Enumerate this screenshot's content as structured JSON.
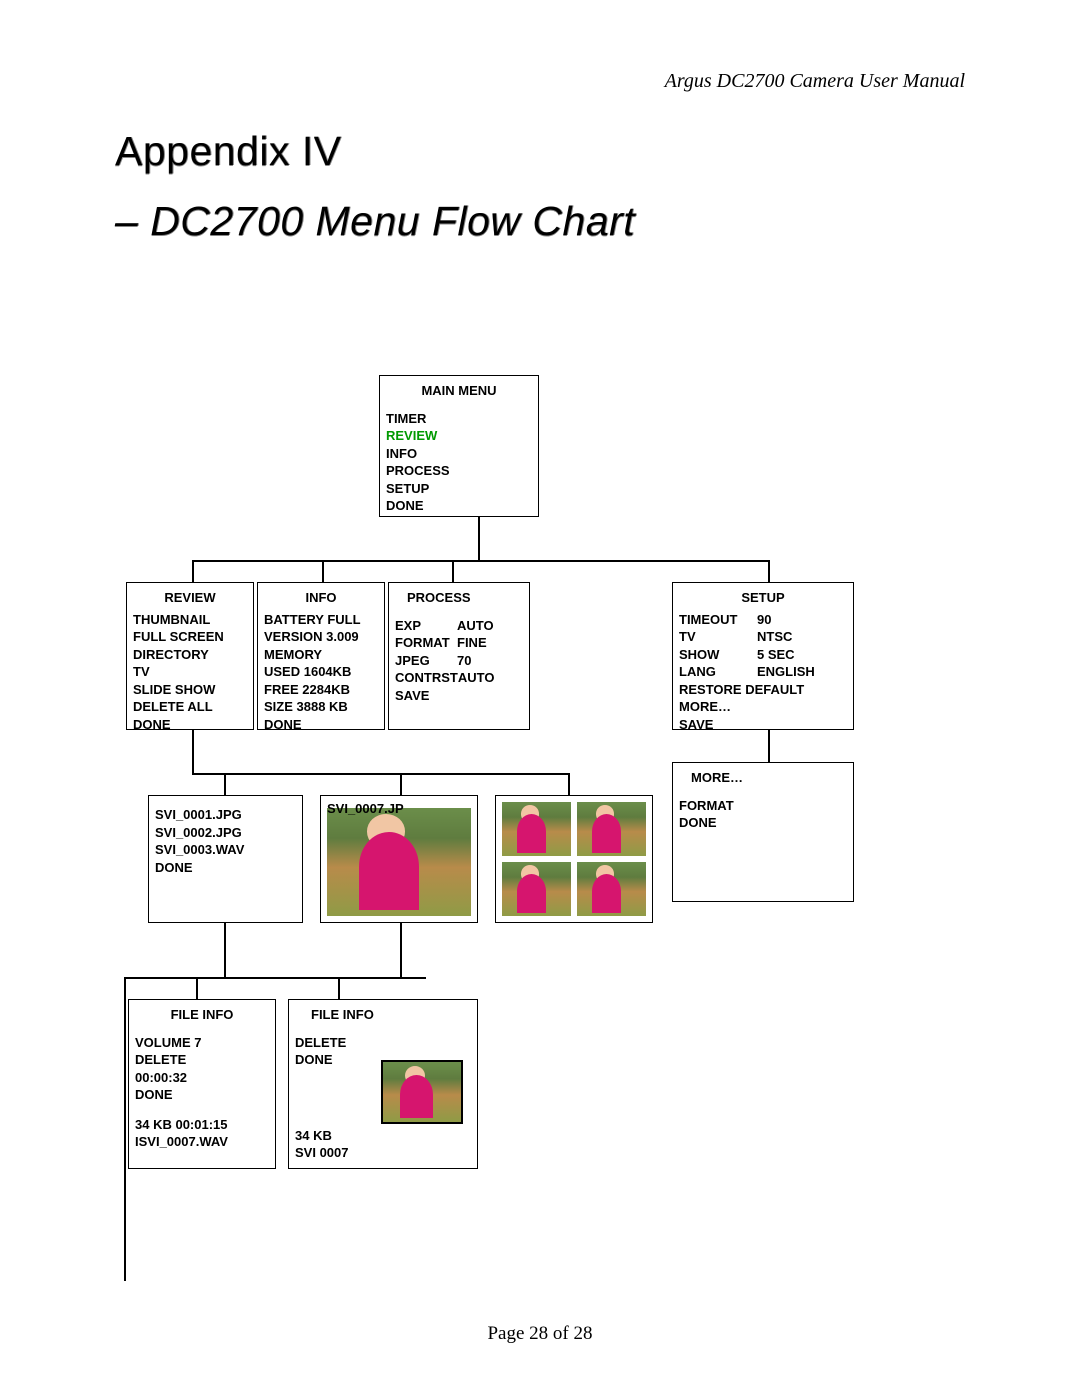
{
  "header": {
    "doc_title": "Argus DC2700 Camera User Manual"
  },
  "title": {
    "line1": "Appendix IV",
    "line2": "– DC2700 Menu Flow Chart"
  },
  "footer": {
    "text": "Page 28 of 28"
  },
  "main_menu": {
    "title": "MAIN MENU",
    "items": [
      "TIMER",
      "REVIEW",
      "INFO",
      "PROCESS",
      "SETUP",
      "DONE"
    ],
    "highlighted_index": 1
  },
  "review": {
    "title": "REVIEW",
    "items": [
      "THUMBNAIL",
      "FULL SCREEN",
      "DIRECTORY",
      "TV",
      "SLIDE SHOW",
      "DELETE ALL",
      "DONE"
    ]
  },
  "info": {
    "title": "INFO",
    "lines": [
      "BATTERY FULL",
      "VERSION 3.009",
      "MEMORY",
      " USED 1604KB",
      " FREE 2284KB",
      " SIZE  3888 KB",
      "DONE"
    ]
  },
  "process": {
    "title": "PROCESS",
    "rows": [
      {
        "k": "EXP",
        "v": "AUTO"
      },
      {
        "k": "FORMAT",
        "v": "FINE"
      },
      {
        "k": "JPEG",
        "v": "70"
      },
      {
        "k": "CONTRST",
        "v": "AUTO"
      },
      {
        "k": "SAVE",
        "v": ""
      }
    ]
  },
  "setup": {
    "title": "SETUP",
    "rows": [
      {
        "k": "TIMEOUT",
        "v": "90"
      },
      {
        "k": "TV",
        "v": "NTSC"
      },
      {
        "k": "SHOW",
        "v": "5 SEC"
      },
      {
        "k": "LANG",
        "v": "ENGLISH"
      },
      {
        "k": "RESTORE DEFAULT",
        "v": ""
      },
      {
        "k": "MORE…",
        "v": ""
      },
      {
        "k": "SAVE",
        "v": ""
      }
    ]
  },
  "more": {
    "title": "MORE…",
    "items": [
      "FORMAT",
      "DONE"
    ]
  },
  "directory": {
    "items": [
      "SVI_0001.JPG",
      "SVI_0002.JPG",
      "SVI_0003.WAV",
      "DONE"
    ]
  },
  "fullscreen_caption": "SVI_0007.JP",
  "file_info_wav": {
    "title": "FILE INFO",
    "lines": [
      "VOLUME    7",
      "DELETE",
      "00:00:32",
      "DONE",
      "",
      "34 KB  00:01:15",
      "ISVI_0007.WAV"
    ]
  },
  "file_info_jpg": {
    "title": "FILE INFO",
    "lines": [
      "DELETE",
      "DONE"
    ],
    "footer_lines": [
      "34 KB",
      "SVI  0007"
    ]
  }
}
